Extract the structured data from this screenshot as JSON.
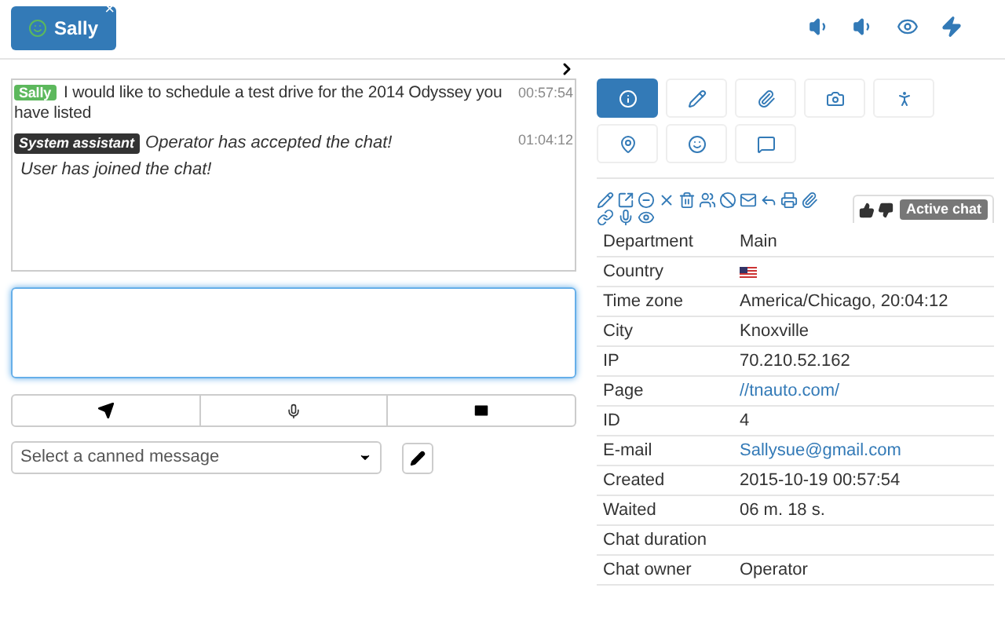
{
  "chat_tab": {
    "label": "Sally",
    "close": "×"
  },
  "messages": [
    {
      "kind": "user",
      "sender": "Sally",
      "text": "I would like to schedule a test drive for the 2014 Odyssey you have listed",
      "time": "00:57:54"
    },
    {
      "kind": "system",
      "sender": "System assistant",
      "lines": [
        "Operator has accepted the chat!",
        "User has joined the chat!"
      ],
      "time": "01:04:12"
    }
  ],
  "canned": {
    "placeholder": "Select a canned message"
  },
  "info_tabs": [
    {
      "selected": true
    },
    {
      "selected": false
    },
    {
      "selected": false
    },
    {
      "selected": false
    },
    {
      "selected": false
    },
    {
      "selected": false
    },
    {
      "selected": false
    },
    {
      "selected": false
    }
  ],
  "status_badge": "Active chat",
  "details": [
    {
      "label": "Department",
      "kind": "text",
      "value": "Main"
    },
    {
      "label": "Country",
      "kind": "flag"
    },
    {
      "label": "Time zone",
      "kind": "text",
      "value": "America/Chicago, 20:04:12"
    },
    {
      "label": "City",
      "kind": "text",
      "value": "Knoxville"
    },
    {
      "label": "IP",
      "kind": "text",
      "value": "70.210.52.162"
    },
    {
      "label": "Page",
      "kind": "link",
      "value": "//tnauto.com/"
    },
    {
      "label": "ID",
      "kind": "text",
      "value": "4"
    },
    {
      "label": "E-mail",
      "kind": "link",
      "value": "Sallysue@gmail.com"
    },
    {
      "label": "Created",
      "kind": "text",
      "value": "2015-10-19 00:57:54"
    },
    {
      "label": "Waited",
      "kind": "text",
      "value": "06 m. 18 s."
    },
    {
      "label": "Chat duration",
      "kind": "text"
    },
    {
      "label": "Chat owner",
      "kind": "text",
      "value": "Operator"
    }
  ]
}
